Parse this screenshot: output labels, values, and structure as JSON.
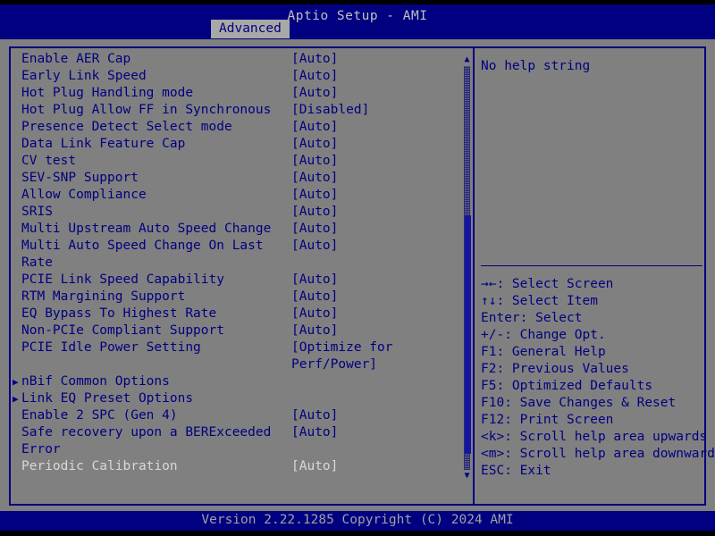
{
  "header": {
    "title": "Aptio Setup - AMI",
    "tab_label": "Advanced"
  },
  "colors": {
    "background": "#808080",
    "panel_blue": "#000080",
    "text_blue": "#000080",
    "text_grey": "#c0c0c0",
    "dim_grey": "#d8d8d8",
    "scrollbar_thumb": "#1515a0"
  },
  "options": [
    {
      "label": "Enable AER Cap",
      "value": "[Auto]",
      "submenu": false,
      "dim": false,
      "wrap": null
    },
    {
      "label": "Early Link Speed",
      "value": "[Auto]",
      "submenu": false,
      "dim": false,
      "wrap": null
    },
    {
      "label": "Hot Plug Handling mode",
      "value": "[Auto]",
      "submenu": false,
      "dim": false,
      "wrap": null
    },
    {
      "label": "Hot Plug Allow FF in Synchronous",
      "value": "[Disabled]",
      "submenu": false,
      "dim": false,
      "wrap": null
    },
    {
      "label": "Presence Detect Select mode",
      "value": "[Auto]",
      "submenu": false,
      "dim": false,
      "wrap": null
    },
    {
      "label": "Data Link Feature Cap",
      "value": "[Auto]",
      "submenu": false,
      "dim": false,
      "wrap": null
    },
    {
      "label": "CV test",
      "value": "[Auto]",
      "submenu": false,
      "dim": false,
      "wrap": null
    },
    {
      "label": "SEV-SNP Support",
      "value": "[Auto]",
      "submenu": false,
      "dim": false,
      "wrap": null
    },
    {
      "label": "Allow Compliance",
      "value": "[Auto]",
      "submenu": false,
      "dim": false,
      "wrap": null
    },
    {
      "label": "SRIS",
      "value": "[Auto]",
      "submenu": false,
      "dim": false,
      "wrap": null
    },
    {
      "label": "Multi Upstream Auto Speed Change",
      "value": "[Auto]",
      "submenu": false,
      "dim": false,
      "wrap": null
    },
    {
      "label": "Multi Auto Speed Change On Last",
      "value": "[Auto]",
      "submenu": false,
      "dim": false,
      "wrap": "Rate"
    },
    {
      "label": "PCIE Link Speed Capability",
      "value": "[Auto]",
      "submenu": false,
      "dim": false,
      "wrap": null
    },
    {
      "label": "RTM Margining Support",
      "value": "[Auto]",
      "submenu": false,
      "dim": false,
      "wrap": null
    },
    {
      "label": "EQ Bypass To Highest Rate",
      "value": "[Auto]",
      "submenu": false,
      "dim": false,
      "wrap": null
    },
    {
      "label": "Non-PCIe Compliant Support",
      "value": "[Auto]",
      "submenu": false,
      "dim": false,
      "wrap": null
    },
    {
      "label": "PCIE Idle Power Setting",
      "value": "[Optimize for",
      "submenu": false,
      "dim": false,
      "wrap": null
    },
    {
      "label": "",
      "value": "Perf/Power]",
      "submenu": false,
      "dim": false,
      "wrap": null
    },
    {
      "label": "nBif Common Options",
      "value": "",
      "submenu": true,
      "dim": false,
      "wrap": null
    },
    {
      "label": "Link EQ Preset Options",
      "value": "",
      "submenu": true,
      "dim": false,
      "wrap": null
    },
    {
      "label": "Enable 2 SPC (Gen 4)",
      "value": "[Auto]",
      "submenu": false,
      "dim": false,
      "wrap": null
    },
    {
      "label": "Safe recovery upon a BERExceeded",
      "value": "[Auto]",
      "submenu": false,
      "dim": false,
      "wrap": "Error"
    },
    {
      "label": "Periodic Calibration",
      "value": "[Auto]",
      "submenu": false,
      "dim": true,
      "wrap": null
    }
  ],
  "scrollbar": {
    "up_arrow": "▲",
    "down_arrow": "▼",
    "thumb_top_pct": 37,
    "thumb_height_pct": 59
  },
  "help": {
    "text": "No help string"
  },
  "keys": [
    "→←: Select Screen",
    "↑↓: Select Item",
    "Enter: Select",
    "+/-: Change Opt.",
    "F1: General Help",
    "F2: Previous Values",
    "F5: Optimized Defaults",
    "F10: Save Changes & Reset",
    "F12: Print Screen",
    "<k>: Scroll help area upwards",
    "<m>: Scroll help area downwards",
    "ESC: Exit"
  ],
  "footer": {
    "text": "Version 2.22.1285 Copyright (C) 2024 AMI"
  }
}
